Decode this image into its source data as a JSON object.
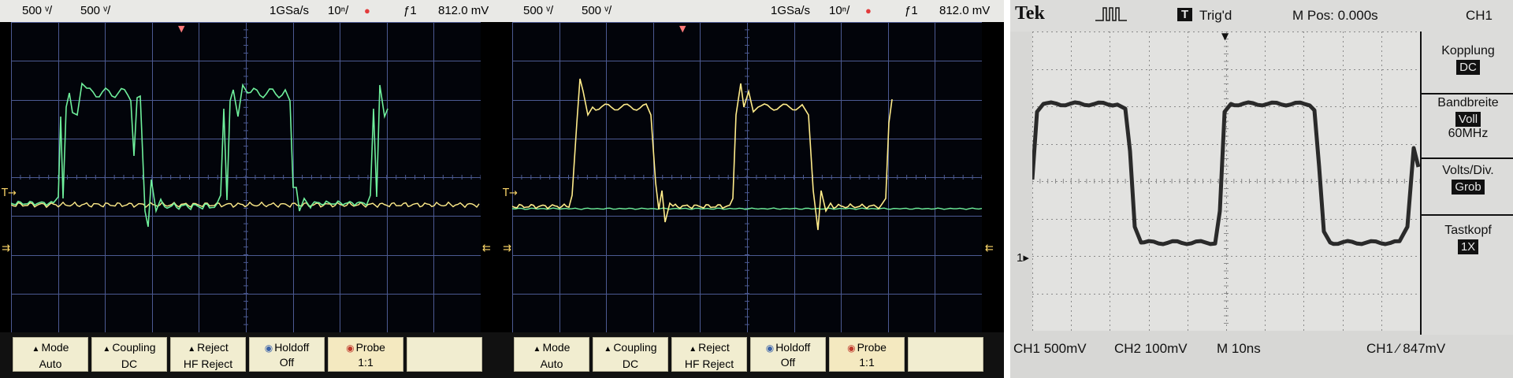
{
  "scope_a": {
    "status": {
      "ch1_scale": "500 ᵛ/",
      "ch2_scale": "500 ᵛ/",
      "sample_rate": "1GSa/s",
      "time_div": "10ⁿ/",
      "rec_icon": "●",
      "trigger": "ƒ1",
      "trigger_level": "812.0 mV"
    },
    "softkeys": [
      {
        "title": "Mode",
        "value": "Auto"
      },
      {
        "title": "Coupling",
        "value": "DC"
      },
      {
        "title": "Reject",
        "value": "HF Reject"
      },
      {
        "title": "Holdoff",
        "value": "Off"
      },
      {
        "title": "Probe",
        "value": "1:1"
      }
    ]
  },
  "scope_b": {
    "status": {
      "ch1_scale": "500 ᵛ/",
      "ch2_scale": "500 ᵛ/",
      "sample_rate": "1GSa/s",
      "time_div": "10ⁿ/",
      "rec_icon": "●",
      "trigger": "ƒ1",
      "trigger_level": "812.0 mV"
    },
    "softkeys": [
      {
        "title": "Mode",
        "value": "Auto"
      },
      {
        "title": "Coupling",
        "value": "DC"
      },
      {
        "title": "Reject",
        "value": "HF Reject"
      },
      {
        "title": "Holdoff",
        "value": "Off"
      },
      {
        "title": "Probe",
        "value": "1:1"
      }
    ]
  },
  "scope_c": {
    "logo": "Tek",
    "trigger_state": "Trig'd",
    "trigger_badge": "T",
    "position": "M Pos: 0.000s",
    "channel": "CH1",
    "side_menu": [
      {
        "label": "Kopplung",
        "value": "DC"
      },
      {
        "label": "Bandbreite",
        "value": "Voll",
        "extra": "60MHz"
      },
      {
        "label": "Volts/Div.",
        "value": "Grob"
      },
      {
        "label": "Tastkopf",
        "value": "1X"
      }
    ],
    "bottom": {
      "ch1": "CH1  500mV",
      "ch2": "CH2  100mV",
      "time": "M 10ns",
      "trigger": "CH1  ⁄  847mV"
    },
    "ground_marker": "1▸"
  },
  "colors": {
    "ch1_trace": "#ffec8a",
    "ch2_trace": "#6ff09c",
    "grid": "#4c5a92",
    "tek_trace": "#2a2a2a"
  }
}
